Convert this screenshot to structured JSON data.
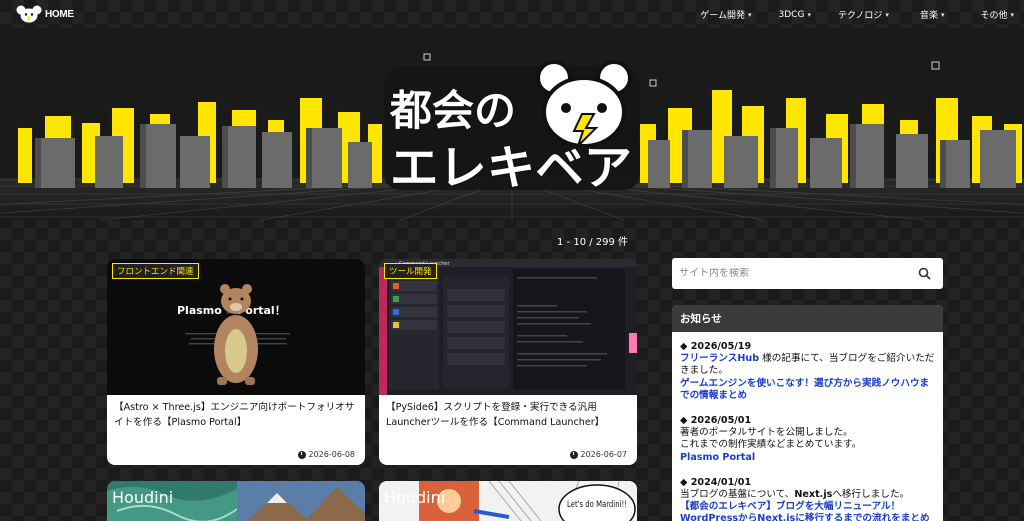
{
  "header": {
    "home_label": "HOME",
    "nav": [
      {
        "label": "ゲーム開発"
      },
      {
        "label": "3DCG"
      },
      {
        "label": "テクノロジ"
      },
      {
        "label": "音楽"
      },
      {
        "label": "その他"
      }
    ]
  },
  "hero": {
    "logo_line1": "都会の",
    "logo_line2": "エレキベア",
    "colors": {
      "accent_yellow": "#ffe600",
      "building_gray": "#6b6b6b",
      "bg_dark": "#1a1a1a"
    }
  },
  "listing": {
    "count": "1 - 10 / 299 件",
    "cards": [
      {
        "tag": "フロントエンド関連",
        "thumb_text": "Plasmo ⚡ Portal！",
        "title": "【Astro × Three.js】エンジニア向けポートフォリオサイトを作る【Plasmo Portal】",
        "date": "2026-06-08"
      },
      {
        "tag": "ツール開発",
        "thumb_text": "Command Launcher",
        "title": "【PySide6】スクリプトを登録・実行できる汎用Launcherツールを作る【Command Launcher】",
        "date": "2026-06-07"
      },
      {
        "tag": "Houdini"
      },
      {
        "tag": "Houdini",
        "thumb_text": "Let's do Mardini!!"
      }
    ]
  },
  "sidebar": {
    "search_placeholder": "サイト内を検索",
    "news_title": "お知らせ",
    "news": [
      {
        "date": "◆ 2026/05/19",
        "lines": [
          {
            "text": "フリーランスHub",
            "link": true
          },
          {
            "text": " 様の記事にて、当ブログをご紹介いただきました。",
            "link": false
          },
          {
            "text": "ゲームエンジンを使いこなす！選び方から実践ノウハウまでの情報まとめ",
            "link": true,
            "block": true
          }
        ]
      },
      {
        "date": "◆ 2026/05/01",
        "lines": [
          {
            "text": "著者のポータルサイトを公開しました。",
            "link": false,
            "block": true
          },
          {
            "text": "これまでの制作実績などまとめています。",
            "link": false,
            "block": true
          },
          {
            "text": "Plasmo Portal",
            "link": true,
            "block": true
          }
        ]
      },
      {
        "date": "◆ 2024/01/01",
        "lines": [
          {
            "text": "当ブログの基盤について、",
            "link": false
          },
          {
            "text": "Next.js",
            "link": false,
            "bold": true
          },
          {
            "text": "へ移行しました。",
            "link": false
          },
          {
            "text": "【都会のエレキベア】ブログを大幅リニューアル！WordPressからNext.jsに移行するまでの流れをまとめ",
            "link": true,
            "block": true
          }
        ]
      }
    ]
  }
}
